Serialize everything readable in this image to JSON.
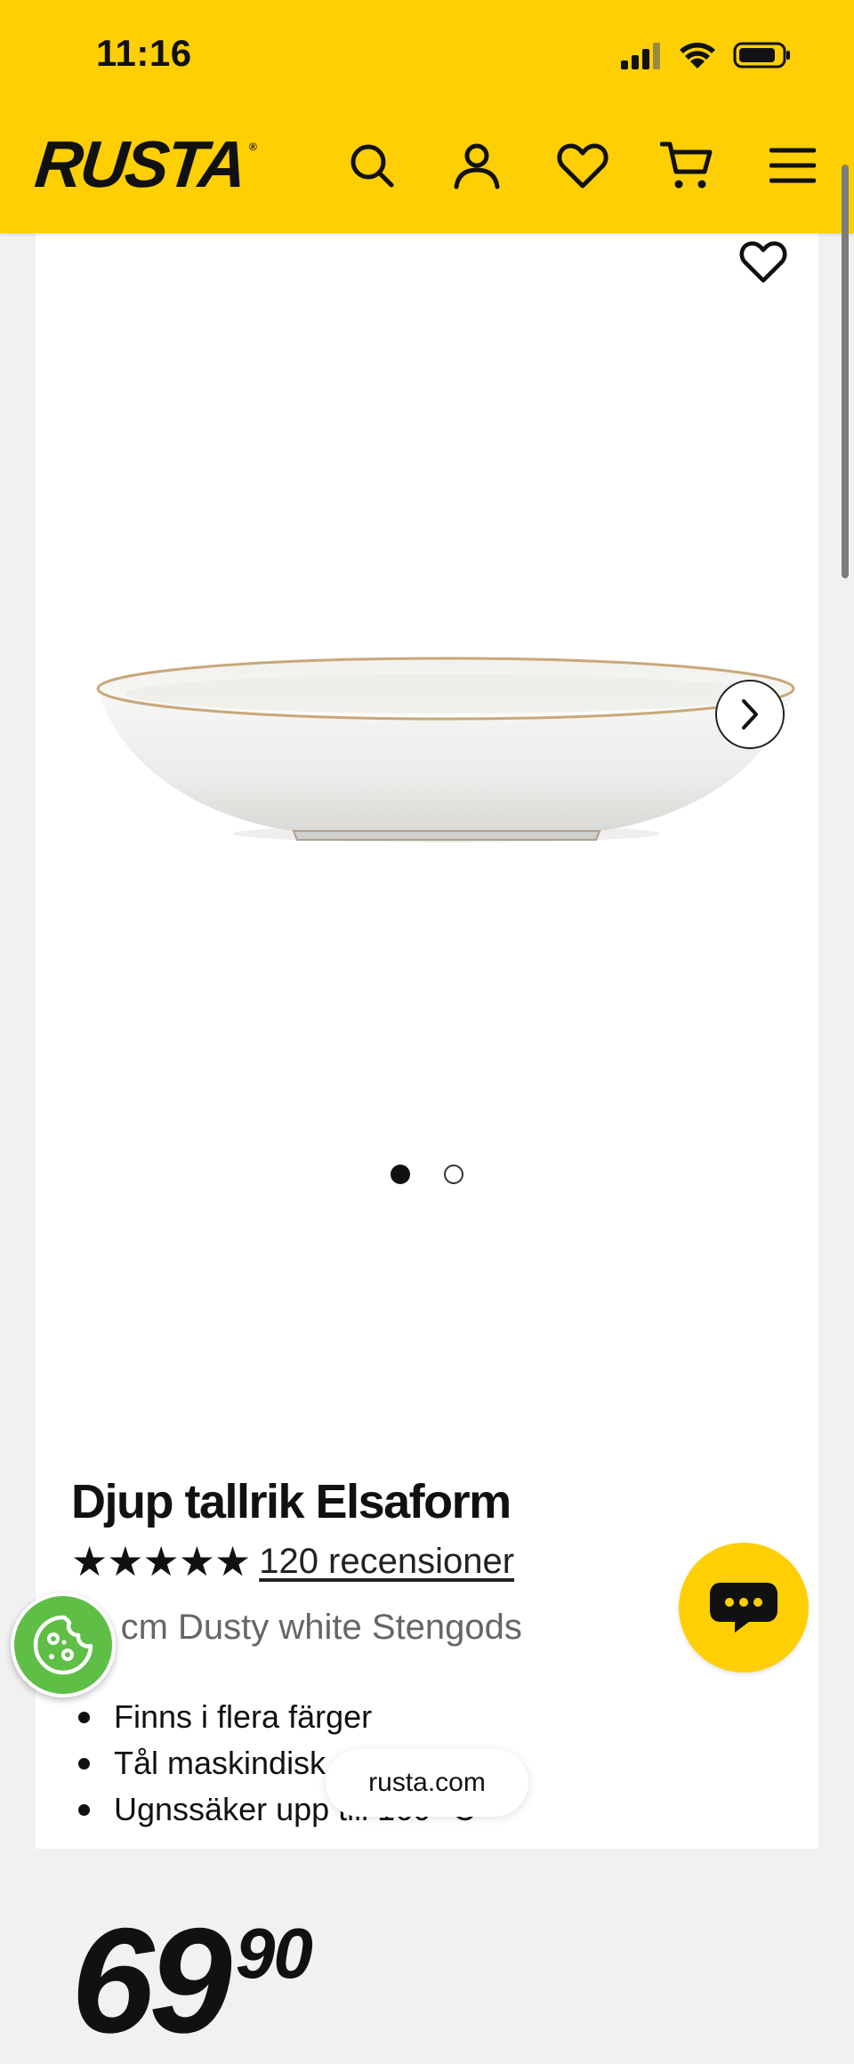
{
  "status_bar": {
    "time": "11:16"
  },
  "header": {
    "logo": "RUSTA",
    "logo_mark": "®",
    "icons": [
      "search-icon",
      "account-icon",
      "heart-icon",
      "cart-icon",
      "menu-icon"
    ],
    "background": "#fecf05"
  },
  "product": {
    "title": "Djup tallrik Elsaform",
    "stars": "★★★★★",
    "rating": 5,
    "reviews": "120 recensioner",
    "subtitle": "20 cm Dusty white Stengods",
    "features": [
      "Finns i flera färger",
      "Tål maskindisk",
      "Ugnssäker upp till 160 °C"
    ],
    "price_main": "69",
    "price_decimals": "90",
    "gallery": {
      "current": 1,
      "total": 2
    }
  },
  "browser": {
    "url": "rusta.com"
  },
  "colors": {
    "accent": "#fecf05",
    "cookie": "#5fbe46",
    "text": "#111111",
    "muted": "#666666"
  }
}
